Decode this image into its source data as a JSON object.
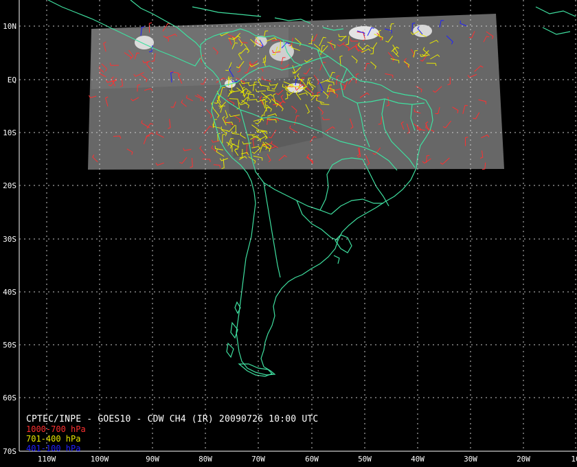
{
  "title": "CPTEC/INPE - GOES10 - CDW CH4 (IR) 20090726 10:00 UTC",
  "legend": [
    {
      "label": "1000-700 hPa",
      "color": "#ff3030"
    },
    {
      "label": "701-400 hPa",
      "color": "#e8e800"
    },
    {
      "label": "401-100 hPa",
      "color": "#2020ff"
    }
  ],
  "lat_labels": [
    "10N",
    "EQ",
    "10S",
    "20S",
    "30S",
    "40S",
    "50S",
    "60S",
    "70S"
  ],
  "lon_labels": [
    "110W",
    "100W",
    "90W",
    "80W",
    "70W",
    "60W",
    "50W",
    "40W",
    "30W",
    "20W",
    "10"
  ],
  "colors": {
    "coast": "#3fe0a0",
    "grid": "#cccccc",
    "background": "#000000",
    "satellite": "#6e6e6e"
  }
}
